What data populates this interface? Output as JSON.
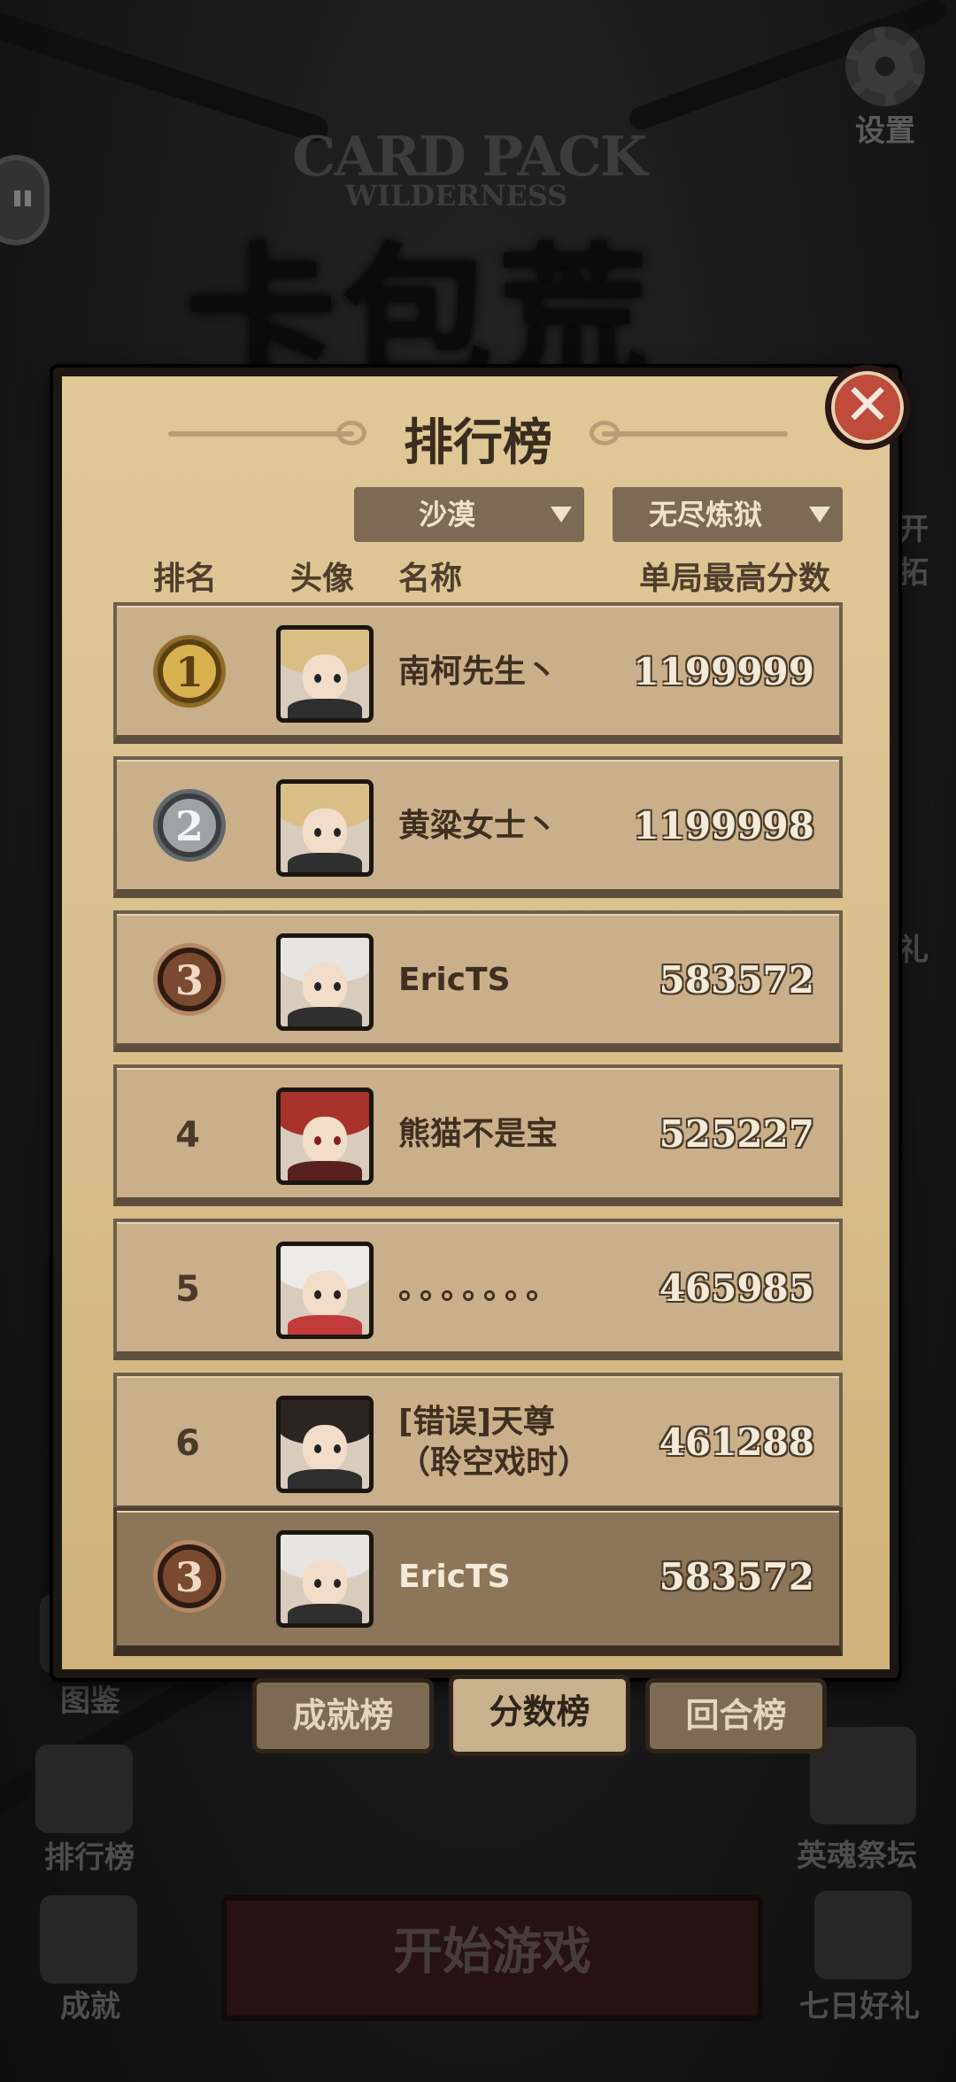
{
  "background": {
    "logo_en_line1": "CARD PACK",
    "logo_en_line2": "WILDERNESS",
    "logo_cn": "卡包荒野",
    "settings_label": "设置",
    "side_right_top": "开拓",
    "side_right_mid": "礼",
    "left_bottom_1": "图鉴",
    "left_bottom_2": "排行榜",
    "left_bottom_3": "成就",
    "right_bottom_1": "英魂祭坛",
    "right_bottom_2": "七日好礼",
    "start_button": "开始游戏"
  },
  "panel": {
    "title": "排行榜",
    "close_label": "✕",
    "filter_map": "沙漠",
    "filter_mode": "无尽炼狱",
    "headers": {
      "rank": "排名",
      "avatar": "头像",
      "name": "名称",
      "score": "单局最高分数"
    },
    "rows": [
      {
        "rank": "1",
        "name": "南柯先生丶",
        "score": "1199999"
      },
      {
        "rank": "2",
        "name": "黄粱女士丶",
        "score": "1199998"
      },
      {
        "rank": "3",
        "name": "EricTS",
        "score": "583572"
      },
      {
        "rank": "4",
        "name": "熊猫不是宝",
        "score": "525227"
      },
      {
        "rank": "5",
        "name": "。。。。。。。",
        "score": "465985"
      },
      {
        "rank": "6",
        "name": "[错误]天尊（聆空戏时）",
        "score": "461288"
      }
    ],
    "my_row": {
      "rank": "3",
      "name": "EricTS",
      "score": "583572"
    }
  },
  "tabs": {
    "achievement": "成就榜",
    "score": "分数榜",
    "round": "回合榜"
  },
  "colors": {
    "panel_bg": "#d8bf8c",
    "row_bg": "#c9b08a",
    "my_row_bg": "#8c7558",
    "close_red": "#bf4b3d",
    "gold": "#d8b24e",
    "silver": "#9fa3a6",
    "bronze": "#7a4a30"
  }
}
